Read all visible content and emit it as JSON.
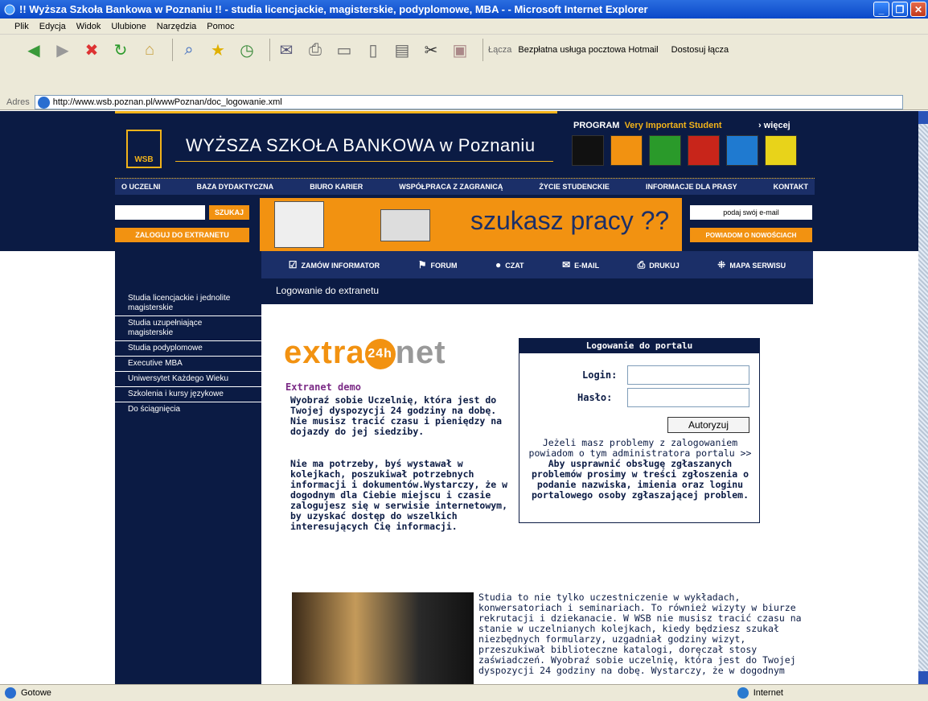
{
  "window": {
    "title": "!! Wyższa Szkoła Bankowa w Poznaniu !! - studia licencjackie, magisterskie, podyplomowe, MBA -  - Microsoft Internet Explorer",
    "btn_min": "_",
    "btn_max": "❐",
    "btn_close": "✕"
  },
  "menubar": {
    "items": [
      "Plik",
      "Edycja",
      "Widok",
      "Ulubione",
      "Narzędzia",
      "Pomoc"
    ]
  },
  "toolbar": {
    "links_label": "Łącza",
    "link1": "Bezpłatna usługa pocztowa Hotmail",
    "link2": "Dostosuj łącza",
    "address_label": "Adres",
    "address_value": "http://www.wsb.poznan.pl/wwwPoznan/doc_logowanie.xml"
  },
  "site": {
    "logo_text": "WSB",
    "name": "WYŻSZA SZKOŁA BANKOWA w Poznaniu",
    "vip_program": "PROGRAM",
    "vip_label": "Very Important Student",
    "vip_more": "› więcej",
    "nav": [
      "O UCZELNI",
      "BAZA DYDAKTYCZNA",
      "BIURO KARIER",
      "WSPÓŁPRACA Z ZAGRANICĄ",
      "ŻYCIE STUDENCKIE",
      "INFORMACJE DLA PRASY",
      "KONTAKT"
    ],
    "search_button": "SZUKAJ",
    "login_button": "ZALOGUJ DO EXTRANETU",
    "banner_slogan": "szukasz pracy ??",
    "email_placeholder": "podaj swój e-mail",
    "notify_button": "POWIADOM O NOWOŚCIACH"
  },
  "tools": [
    "ZAMÓW INFORMATOR",
    "FORUM",
    "CZAT",
    "E-MAIL",
    "DRUKUJ",
    "MAPA SERWISU"
  ],
  "sidebar": {
    "items": [
      "Studia licencjackie i jednolite magisterskie",
      "Studia uzupełniające magisterskie",
      "Studia podyplomowe",
      "Executive MBA",
      "Uniwersytet Każdego Wieku",
      "Szkolenia i kursy językowe",
      "Do ściągnięcia"
    ]
  },
  "page": {
    "title": "Logowanie do extranetu",
    "extra_logo_a": "extra",
    "extra_logo_b": "24h",
    "extra_logo_c": "net",
    "demo_heading": "Extranet demo",
    "desc1": "Wyobraź sobie Uczelnię, która jest do Twojej dyspozycji 24 godziny na dobę. Nie musisz tracić czasu i pieniędzy na dojazdy do jej siedziby.",
    "desc2": "Nie ma potrzeby, byś wystawał w kolejkach, poszukiwał potrzebnych informacji i dokumentów.Wystarczy, że w dogodnym dla Ciebie miejscu i czasie zalogujesz się w serwisie internetowym, by uzyskać dostęp do wszelkich interesujących Cię informacji.",
    "body2": "Studia to nie tylko uczestniczenie w wykładach, konwersatoriach i seminariach. To również wizyty w biurze rekrutacji i dziekanacie. W WSB nie musisz tracić czasu na stanie w uczelnianych kolejkach, kiedy będziesz szukał niezbędnych formularzy, uzgadniał godziny wizyt, przeszukiwał biblioteczne katalogi, doręczał stosy zaświadczeń. Wyobraź sobie uczelnię, która jest do Twojej dyspozycji 24 godziny na dobę. Wystarczy, że w dogodnym"
  },
  "portal": {
    "header": "Logowanie do portalu",
    "login_label": "Login:",
    "password_label": "Hasło:",
    "login_value": "",
    "password_value": "",
    "submit": "Autoryzuj",
    "info1": "Jeżeli masz problemy z zalogowaniem powiadom o tym administratora portalu >>",
    "info2": "Aby usprawnić obsługę zgłaszanych problemów prosimy w treści zgłoszenia o podanie nazwiska, imienia oraz loginu portalowego osoby zgłaszającej problem."
  },
  "statusbar": {
    "left": "Gotowe",
    "zone": "Internet"
  },
  "colors": {
    "navy": "#0b1b44",
    "accent": "#f29211",
    "gold": "#f2b31a"
  }
}
